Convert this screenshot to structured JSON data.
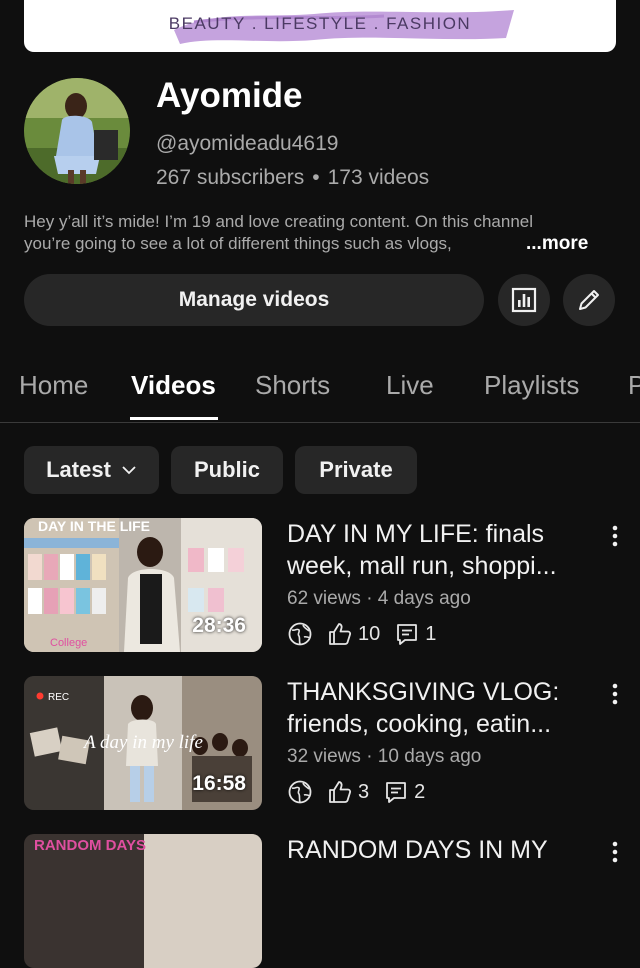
{
  "banner": {
    "tagline": "BEAUTY . LIFESTYLE . FASHION",
    "brush_color": "#c5a3de"
  },
  "channel": {
    "name": "Ayomide",
    "handle": "@ayomideadu4619",
    "subscribers": "267 subscribers",
    "videos": "173 videos",
    "separator": "•",
    "description_line1": "Hey y’all it’s mide! I’m 19 and love creating content. On this channel",
    "description_line2": "you’re going to see a lot of different things such as vlogs,",
    "more_label": "...more"
  },
  "actions": {
    "manage_videos": "Manage videos",
    "analytics_icon": "bar-chart-icon",
    "edit_icon": "pencil-icon"
  },
  "tabs": [
    {
      "label": "Home",
      "active": false
    },
    {
      "label": "Videos",
      "active": true
    },
    {
      "label": "Shorts",
      "active": false
    },
    {
      "label": "Live",
      "active": false
    },
    {
      "label": "Playlists",
      "active": false
    },
    {
      "label": "P",
      "active": false
    }
  ],
  "chips": {
    "sort": "Latest",
    "public": "Public",
    "private": "Private"
  },
  "videos": [
    {
      "title_line1": "DAY IN MY LIFE: finals",
      "title_line2": "week, mall run, shoppi...",
      "meta": "62 views · 4 days ago",
      "likes": "10",
      "comments": "1",
      "duration": "28:36",
      "thumb_text_top": "DAY IN THE LIFE",
      "thumb_text_bottom": "College"
    },
    {
      "title_line1": "THANKSGIVING VLOG:",
      "title_line2": "friends, cooking, eatin...",
      "meta": "32 views · 10 days ago",
      "likes": "3",
      "comments": "2",
      "duration": "16:58",
      "thumb_text_top": "REC",
      "thumb_text_script": "A day in my life"
    },
    {
      "title_line1": "RANDOM DAYS IN MY",
      "thumb_text_top": "RANDOM DAYS"
    }
  ],
  "colors": {
    "background": "#0f0f0f",
    "surface": "#272727",
    "text_primary": "#f1f1f1",
    "text_secondary": "#aaaaaa"
  }
}
